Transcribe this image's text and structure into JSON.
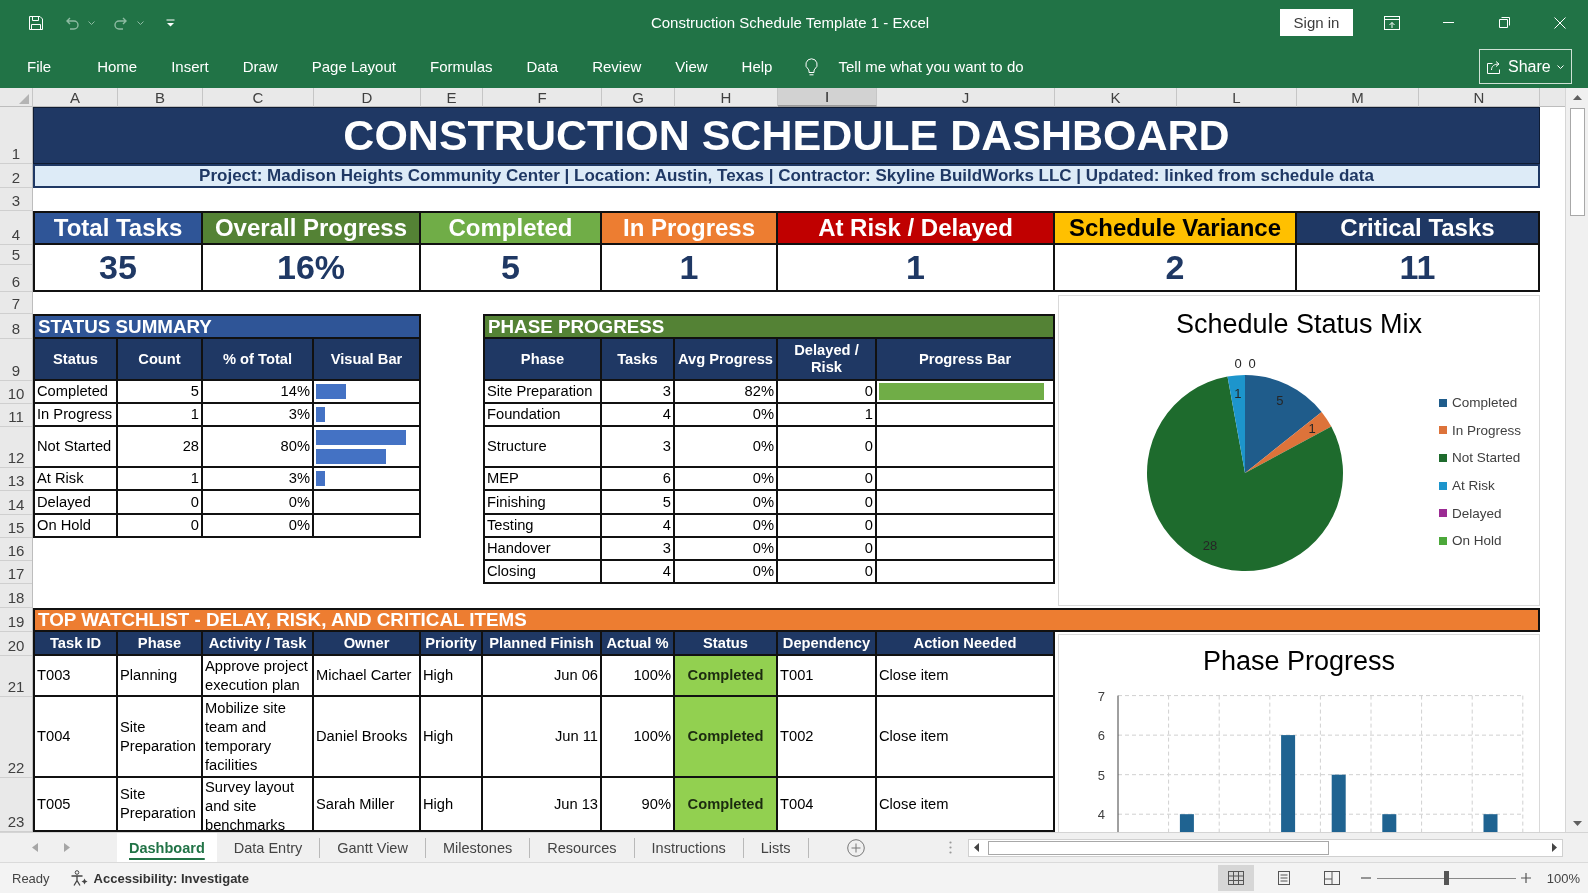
{
  "window": {
    "title": "Construction Schedule Template 1 - Excel",
    "sign_in": "Sign in"
  },
  "quick_access": [
    {
      "kind": "save",
      "disabled": false
    },
    {
      "kind": "undo",
      "disabled": true
    },
    {
      "kind": "redo",
      "disabled": true
    },
    {
      "kind": "customize",
      "disabled": false
    }
  ],
  "ribbon": {
    "tabs": [
      {
        "label": "File",
        "selected": false
      },
      {
        "label": "Home",
        "selected": false
      },
      {
        "label": "Insert",
        "selected": false
      },
      {
        "label": "Draw",
        "selected": false
      },
      {
        "label": "Page Layout",
        "selected": false
      },
      {
        "label": "Formulas",
        "selected": false
      },
      {
        "label": "Data",
        "selected": false
      },
      {
        "label": "Review",
        "selected": false
      },
      {
        "label": "View",
        "selected": false
      },
      {
        "label": "Help",
        "selected": false
      }
    ],
    "tell_me": {
      "placeholder": "Tell me what you want to do"
    },
    "share": "Share"
  },
  "sheet": {
    "column_headers": [
      {
        "label": "A",
        "selected": false
      },
      {
        "label": "B",
        "selected": false
      },
      {
        "label": "C",
        "selected": false
      },
      {
        "label": "D",
        "selected": false
      },
      {
        "label": "E",
        "selected": false
      },
      {
        "label": "F",
        "selected": false
      },
      {
        "label": "G",
        "selected": false
      },
      {
        "label": "H",
        "selected": false
      },
      {
        "label": "I",
        "selected": true
      },
      {
        "label": "J",
        "selected": false
      },
      {
        "label": "K",
        "selected": false
      },
      {
        "label": "L",
        "selected": false
      },
      {
        "label": "M",
        "selected": false
      },
      {
        "label": "N",
        "selected": false
      }
    ],
    "row_numbers": [
      "1",
      "2",
      "3",
      "4",
      "5",
      "6",
      "7",
      "8",
      "9",
      "10",
      "11",
      "12",
      "13",
      "14",
      "15",
      "16",
      "17",
      "18",
      "19",
      "20",
      "21",
      "22",
      "23"
    ],
    "title": "CONSTRUCTION SCHEDULE DASHBOARD",
    "subtitle": "Project: Madison Heights Community Center | Location: Austin, Texas | Contractor: Skyline BuildWorks LLC | Updated: linked from schedule data",
    "kpis": [
      {
        "label": "Total Tasks",
        "value": "35",
        "color": "#2f5597"
      },
      {
        "label": "Overall Progress",
        "value": "16%",
        "color": "#548235"
      },
      {
        "label": "Completed",
        "value": "5",
        "color": "#70ad47"
      },
      {
        "label": "In Progress",
        "value": "1",
        "color": "#ed7d31"
      },
      {
        "label": "At Risk / Delayed",
        "value": "1",
        "color": "#c00000"
      },
      {
        "label": "Schedule Variance",
        "value": "2",
        "color": "#ffc000"
      },
      {
        "label": "Critical Tasks",
        "value": "11",
        "color": "#1f3864"
      }
    ],
    "status_summary": {
      "title": "STATUS SUMMARY",
      "columns": [
        "Status",
        "Count",
        "% of Total",
        "Visual Bar"
      ],
      "rows": [
        {
          "status": "Completed",
          "count": "5",
          "percent": "14%",
          "bars": [
            {
              "level": 0.3
            }
          ]
        },
        {
          "status": "In Progress",
          "count": "1",
          "percent": "3%",
          "bars": [
            {
              "level": 0.09
            }
          ]
        },
        {
          "status": "Not Started",
          "count": "28",
          "percent": "80%",
          "bars": [
            {
              "level": 0.89
            },
            {
              "level": 0.69
            }
          ]
        },
        {
          "status": "At Risk",
          "count": "1",
          "percent": "3%",
          "bars": [
            {
              "level": 0.09
            }
          ]
        },
        {
          "status": "Delayed",
          "count": "0",
          "percent": "0%"
        },
        {
          "status": "On Hold",
          "count": "0",
          "percent": "0%"
        }
      ]
    },
    "phase_progress": {
      "title": "PHASE PROGRESS",
      "columns": [
        "Phase",
        "Tasks",
        "Avg Progress",
        "Delayed / Risk",
        "Progress Bar"
      ],
      "rows": [
        {
          "phase": "Site Preparation",
          "tasks": "3",
          "avg_progress": "82%",
          "delayed_risk": "0",
          "level": 0.96
        },
        {
          "phase": "Foundation",
          "tasks": "4",
          "avg_progress": "0%",
          "delayed_risk": "1"
        },
        {
          "phase": "Structure",
          "tasks": "3",
          "avg_progress": "0%",
          "delayed_risk": "0"
        },
        {
          "phase": "MEP",
          "tasks": "6",
          "avg_progress": "0%",
          "delayed_risk": "0"
        },
        {
          "phase": "Finishing",
          "tasks": "5",
          "avg_progress": "0%",
          "delayed_risk": "0"
        },
        {
          "phase": "Testing",
          "tasks": "4",
          "avg_progress": "0%",
          "delayed_risk": "0"
        },
        {
          "phase": "Handover",
          "tasks": "3",
          "avg_progress": "0%",
          "delayed_risk": "0"
        },
        {
          "phase": "Closing",
          "tasks": "4",
          "avg_progress": "0%",
          "delayed_risk": "0"
        }
      ]
    },
    "status_chart": {
      "chart_data": {
        "type": "pie",
        "title": "Schedule Status Mix",
        "values": [
          5,
          1,
          28,
          1,
          0,
          0
        ],
        "value_labels": [
          "5",
          "1",
          "28",
          "1",
          "0",
          "0"
        ]
      },
      "legend": [
        {
          "label": "Completed",
          "color": "#1f5c8b"
        },
        {
          "label": "In Progress",
          "color": "#dd733a"
        },
        {
          "label": "Not Started",
          "color": "#1e6b2d"
        },
        {
          "label": "At Risk",
          "color": "#1d95cc"
        },
        {
          "label": "Delayed",
          "color": "#9b2b93"
        },
        {
          "label": "On Hold",
          "color": "#4ca83a"
        }
      ]
    },
    "watchlist": {
      "title": "TOP WATCHLIST - DELAY, RISK, AND CRITICAL ITEMS",
      "columns": [
        "Task ID",
        "Phase",
        "Activity / Task",
        "Owner",
        "Priority",
        "Planned Finish",
        "Actual %",
        "Status",
        "Dependency",
        "Action Needed"
      ],
      "rows": [
        {
          "task_id": "T003",
          "phase": "Planning",
          "activity": "Approve project execution plan",
          "owner": "Michael Carter",
          "priority": "High",
          "planned_finish": "Jun 06",
          "actual": "100%",
          "status": "Completed",
          "color": "#92d050",
          "dependency": "T001",
          "action": "Close item"
        },
        {
          "task_id": "T004",
          "phase": "Site Preparation",
          "activity": "Mobilize site team and temporary facilities",
          "owner": "Daniel Brooks",
          "priority": "High",
          "planned_finish": "Jun 11",
          "actual": "100%",
          "status": "Completed",
          "color": "#92d050",
          "dependency": "T002",
          "action": "Close item"
        },
        {
          "task_id": "T005",
          "phase": "Site Preparation",
          "activity": "Survey layout and site benchmarks",
          "owner": "Sarah Miller",
          "priority": "High",
          "planned_finish": "Jun 13",
          "actual": "90%",
          "status": "Completed",
          "color": "#92d050",
          "dependency": "T004",
          "action": "Close item"
        }
      ]
    },
    "phase_chart": {
      "chart_data": {
        "type": "bar",
        "title": "Phase Progress",
        "values": [
          null,
          4,
          null,
          6,
          5,
          4,
          null,
          4
        ],
        "ylim": [
          3.55,
          7
        ],
        "yticks": [
          4,
          5,
          6,
          7
        ],
        "grid": true
      }
    }
  },
  "sheet_tabs": [
    {
      "label": "Dashboard",
      "selected": true
    },
    {
      "label": "Data Entry",
      "selected": false
    },
    {
      "label": "Gantt View",
      "selected": false
    },
    {
      "label": "Milestones",
      "selected": false
    },
    {
      "label": "Resources",
      "selected": false
    },
    {
      "label": "Instructions",
      "selected": false
    },
    {
      "label": "Lists",
      "selected": false
    }
  ],
  "status_bar": {
    "mode": "Ready",
    "accessibility": "Accessibility: Investigate",
    "views": [
      {
        "kind": "normal",
        "selected": true
      },
      {
        "kind": "page_layout",
        "selected": false
      },
      {
        "kind": "page_break",
        "selected": false
      }
    ],
    "zoom_slider": {
      "level": 0.5
    },
    "zoom": "100%"
  }
}
